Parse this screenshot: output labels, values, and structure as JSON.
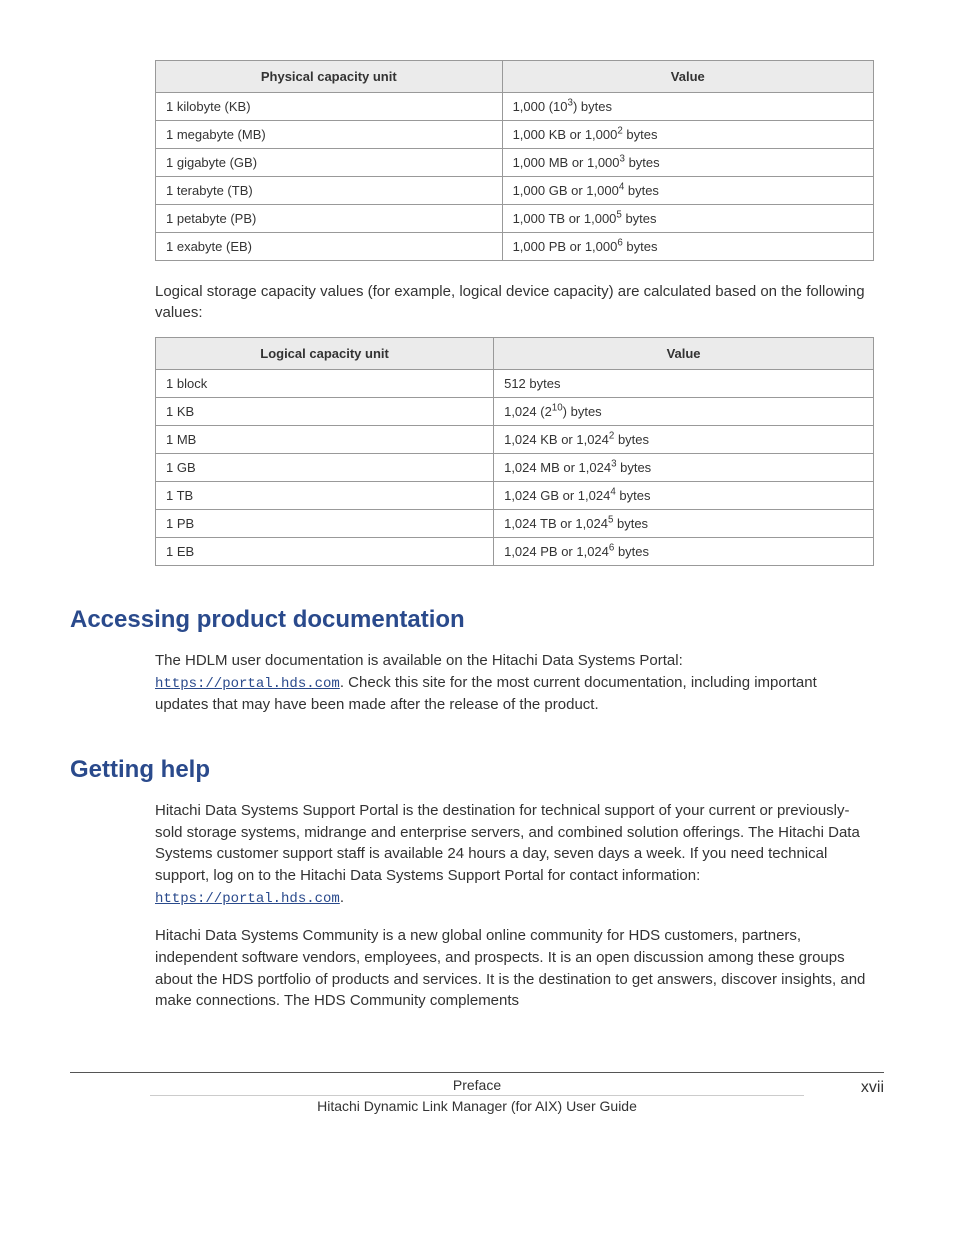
{
  "table1": {
    "headers": [
      "Physical capacity unit",
      "Value"
    ],
    "rows": [
      {
        "unit": "1 kilobyte (KB)",
        "val_pre": "1,000 (10",
        "val_sup": "3",
        "val_post": ") bytes"
      },
      {
        "unit": "1 megabyte (MB)",
        "val_pre": "1,000 KB or 1,000",
        "val_sup": "2",
        "val_post": " bytes"
      },
      {
        "unit": "1 gigabyte (GB)",
        "val_pre": "1,000 MB or 1,000",
        "val_sup": "3",
        "val_post": " bytes"
      },
      {
        "unit": "1 terabyte (TB)",
        "val_pre": "1,000 GB or 1,000",
        "val_sup": "4",
        "val_post": " bytes"
      },
      {
        "unit": "1 petabyte (PB)",
        "val_pre": "1,000 TB or 1,000",
        "val_sup": "5",
        "val_post": " bytes"
      },
      {
        "unit": "1 exabyte (EB)",
        "val_pre": "1,000 PB or 1,000",
        "val_sup": "6",
        "val_post": " bytes"
      }
    ]
  },
  "intro1": "Logical storage capacity values (for example, logical device capacity) are calculated based on the following values:",
  "table2": {
    "headers": [
      "Logical capacity unit",
      "Value"
    ],
    "rows": [
      {
        "unit": "1 block",
        "val_pre": "512 bytes",
        "val_sup": "",
        "val_post": ""
      },
      {
        "unit": "1 KB",
        "val_pre": "1,024 (2",
        "val_sup": "10",
        "val_post": ") bytes"
      },
      {
        "unit": "1 MB",
        "val_pre": "1,024 KB or 1,024",
        "val_sup": "2",
        "val_post": " bytes"
      },
      {
        "unit": "1 GB",
        "val_pre": "1,024 MB or 1,024",
        "val_sup": "3",
        "val_post": " bytes"
      },
      {
        "unit": "1 TB",
        "val_pre": "1,024 GB or 1,024",
        "val_sup": "4",
        "val_post": " bytes"
      },
      {
        "unit": "1 PB",
        "val_pre": "1,024 TB or 1,024",
        "val_sup": "5",
        "val_post": " bytes"
      },
      {
        "unit": "1 EB",
        "val_pre": "1,024 PB or 1,024",
        "val_sup": "6",
        "val_post": " bytes"
      }
    ]
  },
  "section1": {
    "heading": "Accessing product documentation",
    "para_pre": "The HDLM user documentation is available on the Hitachi Data Systems Portal: ",
    "link": "https://portal.hds.com",
    "para_post": ". Check this site for the most current documentation, including important updates that may have been made after the release of the product."
  },
  "section2": {
    "heading": "Getting help",
    "para1_pre": "Hitachi Data Systems Support Portal is the destination for technical support of your current or previously-sold storage systems, midrange and enterprise servers, and combined solution offerings. The Hitachi Data Systems customer support staff is available 24 hours a day, seven days a week. If you need technical support, log on to the Hitachi Data Systems Support Portal for contact information: ",
    "link": "https://portal.hds.com",
    "para1_post": ".",
    "para2": "Hitachi Data Systems Community is a new global online community for HDS customers, partners, independent software vendors, employees, and prospects. It is an open discussion among these groups about the HDS portfolio of products and services. It is the destination to get answers, discover insights, and make connections. The HDS Community complements"
  },
  "footer": {
    "top": "Preface",
    "bottom": "Hitachi Dynamic Link Manager (for AIX) User Guide",
    "page": "xvii"
  }
}
